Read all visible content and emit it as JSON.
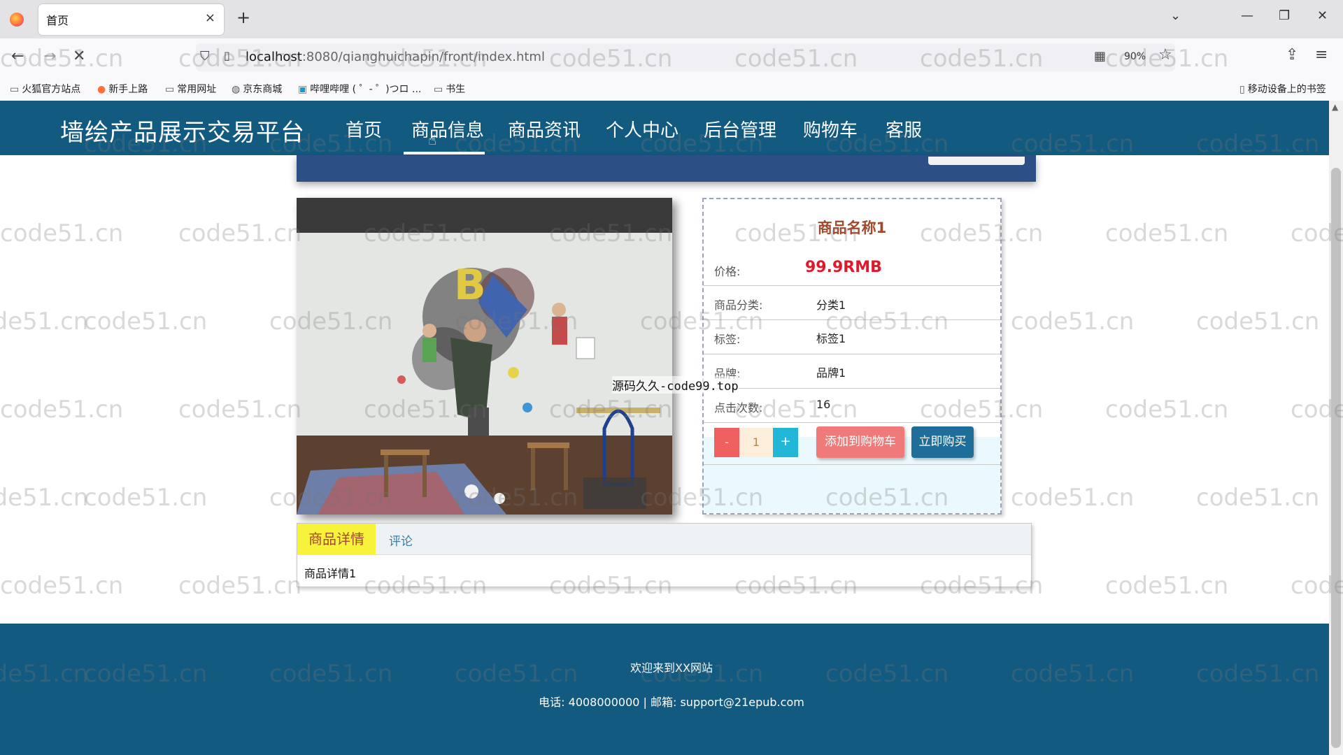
{
  "browser": {
    "tab_title": "首页",
    "tab_close": "×",
    "new_tab": "+",
    "url_host": "localhost",
    "url_path": ":8080/qianghuichapin/front/index.html",
    "zoom": "90%",
    "bookmarks": [
      "火狐官方站点",
      "新手上路",
      "常用网址",
      "京东商城",
      "哔哩哔哩 ( ゜- ゜)つロ ...",
      "书生"
    ],
    "mobile_bookmarks": "移动设备上的书签"
  },
  "site": {
    "title": "墙绘产品展示交易平台",
    "nav": [
      "首页",
      "商品信息",
      "商品资讯",
      "个人中心",
      "后台管理",
      "购物车",
      "客服"
    ]
  },
  "product": {
    "name": "商品名称1",
    "price_label": "价格:",
    "price": "99.9RMB",
    "category_label": "商品分类:",
    "category": "分类1",
    "tag_label": "标签:",
    "tag": "标签1",
    "brand_label": "品牌:",
    "brand": "品牌1",
    "clicks_label": "点击次数:",
    "clicks": "16",
    "qty_minus": "-",
    "quantity": "1",
    "qty_plus": "+",
    "add_to_cart": "添加到购物车",
    "buy_now": "立即购买"
  },
  "tabs": {
    "detail": "商品详情",
    "review": "评论",
    "detail_content": "商品详情1"
  },
  "overlay_text": "源码久久-code99.top",
  "footer": {
    "welcome": "欢迎来到XX网站",
    "contact": "电话: 4008000000 | 邮箱: support@21epub.com"
  },
  "watermark": "code51.cn"
}
